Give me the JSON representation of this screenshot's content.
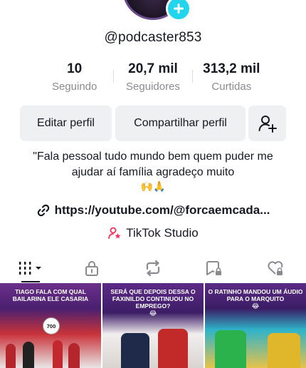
{
  "profile": {
    "username": "@podcaster853",
    "stats": [
      {
        "value": "10",
        "label": "Seguindo"
      },
      {
        "value": "20,7 mil",
        "label": "Seguidores"
      },
      {
        "value": "313,2 mil",
        "label": "Curtidas"
      }
    ],
    "buttons": {
      "edit": "Editar perfil",
      "share": "Compartilhar perfil"
    },
    "bio": "\"Fala pessoal tudo mundo bem quem puder me ajudar aí família agradeço muito",
    "bio_emojis": "🙌🙏",
    "link": "https://youtube.com/@forcaemcada...",
    "studio": "TikTok Studio"
  },
  "tabs": [
    "videos-tab",
    "private-tab",
    "reposts-tab",
    "favorites-tab",
    "liked-tab"
  ],
  "videos": [
    {
      "caption": "TIAGO FALA COM QUAL BAILARINA ELE CASARIA",
      "emoji": "",
      "badge": "700"
    },
    {
      "caption": "SERÁ QUE DEPOIS DESSA O FAXINILDO CONTINUOU NO EMPREGO?",
      "emoji": "😂"
    },
    {
      "caption": "O RATINHO MANDOU UM ÁUDIO PARA O MARQUITO",
      "emoji": "😂"
    }
  ],
  "colors": {
    "text": "#161823",
    "muted": "#8a8b91",
    "button_bg": "#eff0f2",
    "accent": "#fe2c55",
    "avatar_add": "#20d5ec"
  }
}
